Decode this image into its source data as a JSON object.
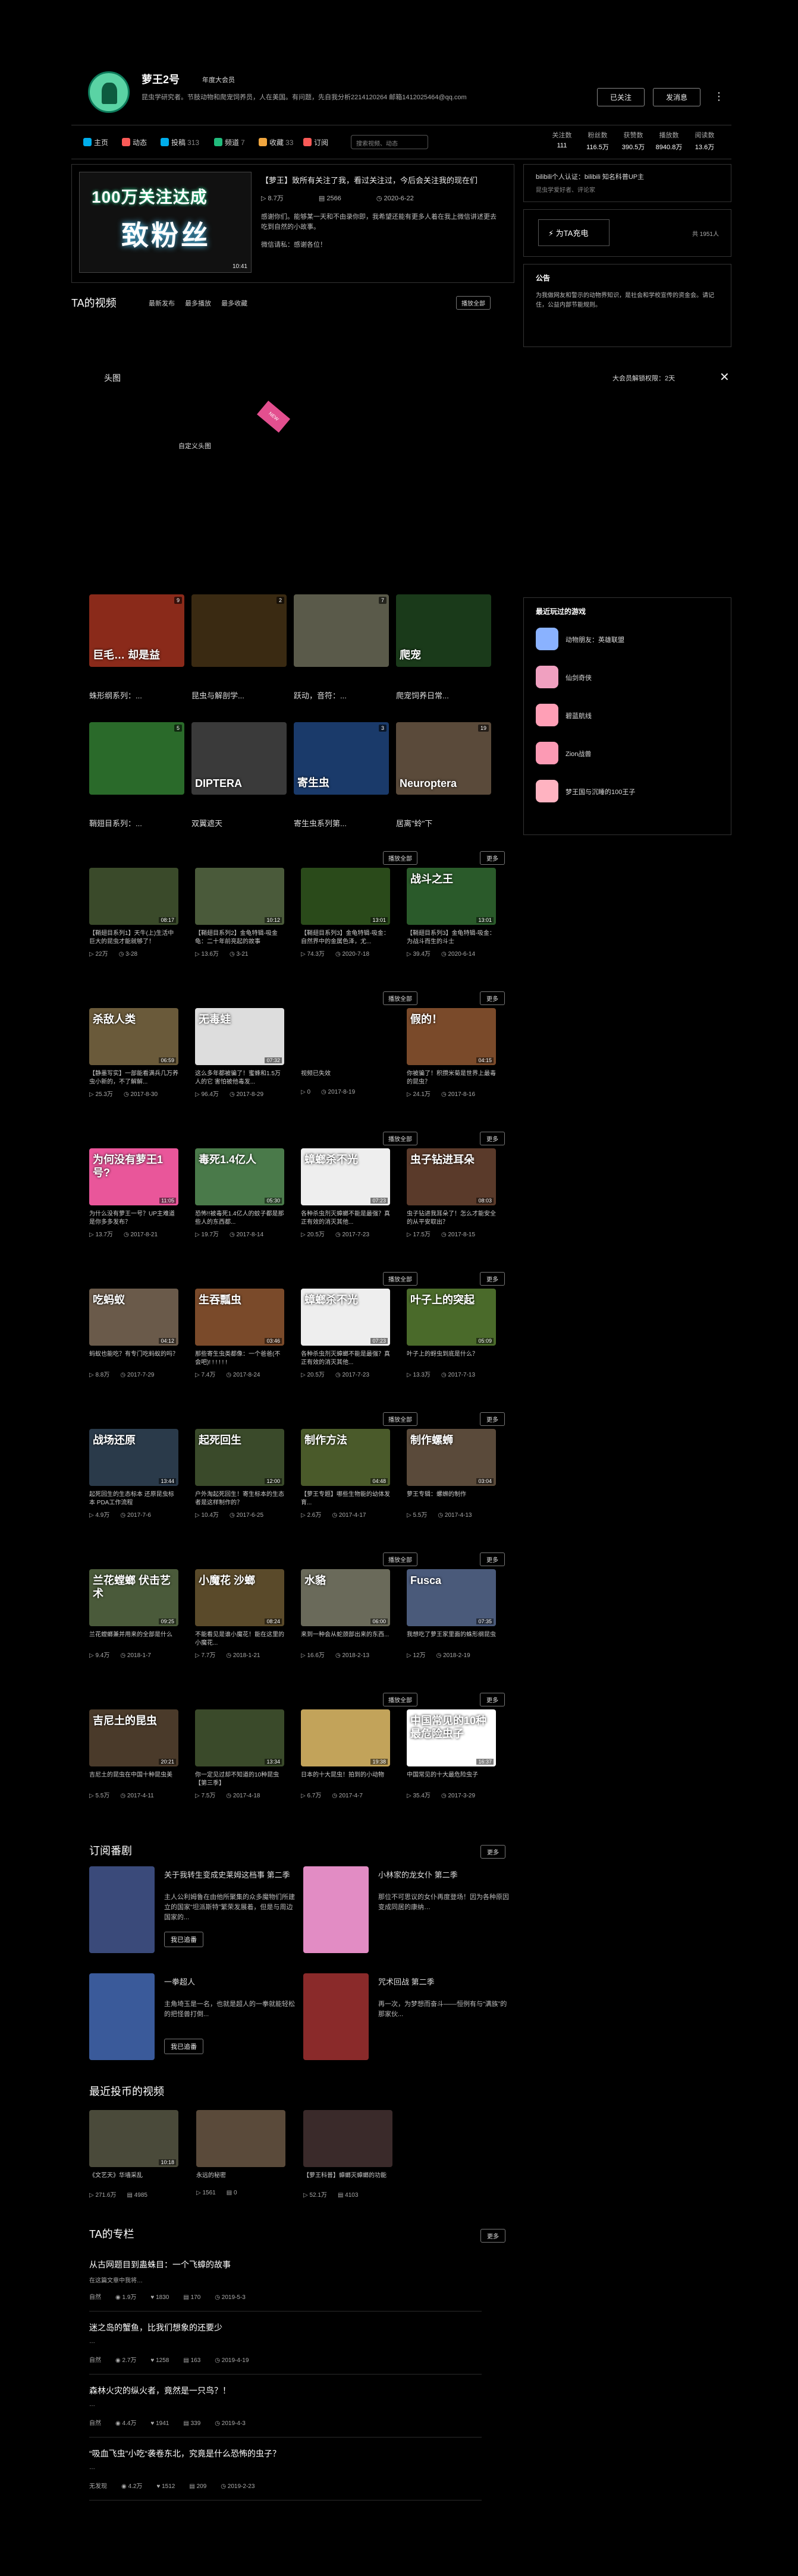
{
  "user": {
    "name": "萝王2号",
    "vip": "年度大会员",
    "sign": "昆虫学研究者。节肢动物和爬宠饲养员，人在美国。有问题，先自我分析2214120264 邮箱1412025464@qq.com",
    "followed_label": "已关注",
    "message_label": "发消息",
    "more_label": "⋮"
  },
  "nav": {
    "items": [
      {
        "label": "主页",
        "count": "",
        "color": "#00aeec"
      },
      {
        "label": "动态",
        "count": "",
        "color": "#fa5a57"
      },
      {
        "label": "投稿",
        "count": "313",
        "color": "#00aeec"
      },
      {
        "label": "频道",
        "count": "7",
        "color": "#21bb7c"
      },
      {
        "label": "收藏",
        "count": "33",
        "color": "#f0a63f"
      },
      {
        "label": "订阅",
        "count": "",
        "color": "#fa5a57"
      }
    ],
    "search_placeholder": "搜索视频、动态",
    "stats": [
      {
        "label": "关注数",
        "value": "111"
      },
      {
        "label": "粉丝数",
        "value": "116.5万"
      },
      {
        "label": "获赞数",
        "value": "390.5万"
      },
      {
        "label": "播放数",
        "value": "8940.8万"
      },
      {
        "label": "阅读数",
        "value": "13.6万"
      }
    ]
  },
  "featured": {
    "thumb_line1": "100万关注达成",
    "thumb_line2": "致粉丝",
    "duration": "10:41",
    "title": "【萝王】致所有关注了我，看过关注过，今后会关注我的现在们",
    "views": "8.7万",
    "comments": "2566",
    "date": "2020-6-22",
    "desc": "感谢你们。能够某一天和不由录你即，我希望还能有更多人着在我上微信讲述更去吃到自然的小故事。",
    "desc2": "微信请私：感谢各位！"
  },
  "videos_section": {
    "title": "TA的视频",
    "tabs": [
      "最新发布",
      "最多播放",
      "最多收藏"
    ],
    "play_all": "播放全部",
    "more": "更多"
  },
  "overlay": {
    "tab": "头图",
    "label": "自定义头图",
    "ribbon": "NEW",
    "note": "大会员解锁权限：2天",
    "close": "✕"
  },
  "channels": [
    {
      "name": "蛛形纲系列：...",
      "badge": "9",
      "text": "巨毛…\n却是益",
      "bg": "#8a2a1a"
    },
    {
      "name": "昆虫与解剖学...",
      "badge": "2",
      "text": "",
      "bg": "#3a2a12"
    },
    {
      "name": "跃动，音符：...",
      "badge": "7",
      "text": "",
      "bg": "#5a5a4a"
    },
    {
      "name": "爬宠饲养日常...",
      "badge": "",
      "text": "爬宠",
      "bg": "#1a3a1a"
    },
    {
      "name": "鞘翅目系列：...",
      "badge": "5",
      "text": "",
      "bg": "#2a6a2a"
    },
    {
      "name": "双翼遮天",
      "badge": "",
      "text": "DIPTERA",
      "bg": "#3a3a3a"
    },
    {
      "name": "寄生虫系列第...",
      "badge": "3",
      "text": "寄生虫",
      "bg": "#1a3a6a"
    },
    {
      "name": "居离\"蛉\"下",
      "badge": "19",
      "text": "Neuroptera",
      "bg": "#5a4a3a"
    }
  ],
  "rows": [
    {
      "more": "更多",
      "play_all": "播放全部",
      "videos": [
        {
          "t": "【鞘翅目系列1】天牛(上)生活中巨大的昆虫才能就够了！",
          "v": "22万",
          "d": "3-28",
          "dur": "08:17",
          "txt": "",
          "bg": "#3a4a2a"
        },
        {
          "t": "【鞘翅目系列2】金龟特辑-吸金龟：二十年前亮起的故事",
          "v": "13.6万",
          "d": "3-21",
          "dur": "10:12",
          "txt": "",
          "bg": "#4a5a3a"
        },
        {
          "t": "【鞘翅目系列3】金龟特辑-吸金：自然界中的金属色泽，尤...",
          "v": "74.3万",
          "d": "2020-7-18",
          "dur": "13:01",
          "txt": "",
          "bg": "#2a4a1a"
        },
        {
          "t": "【鞘翅目系列3】金龟特辑-吸金：为战斗而生的斗士",
          "v": "39.4万",
          "d": "2020-6-14",
          "dur": "13:01",
          "txt": "战斗之王",
          "bg": "#2a5a2a"
        }
      ]
    },
    {
      "more": "更多",
      "play_all": "播放全部",
      "videos": [
        {
          "t": "【静墨写实】一部能看满兵几万养虫小新的，不了解解...",
          "v": "25.3万",
          "d": "2017-8-30",
          "dur": "06:59",
          "txt": "杀敌人类",
          "bg": "#6a5a3a"
        },
        {
          "t": "这么多年都被骗了！蜜蜂和1.5万人的它 害怕被他毒发...",
          "v": "96.4万",
          "d": "2017-8-29",
          "dur": "07:32",
          "txt": "无毒蛙",
          "bg": "#dddddd"
        },
        {
          "t": "视频已失效",
          "v": "0",
          "d": "2017-8-19",
          "dur": "",
          "txt": "",
          "bg": "#000000"
        },
        {
          "t": "你被骗了！积攒米菊是世界上最毒的昆虫？",
          "v": "24.1万",
          "d": "2017-8-16",
          "dur": "04:15",
          "txt": "假的！",
          "bg": "#7a4a2a"
        }
      ]
    },
    {
      "more": "更多",
      "play_all": "播放全部",
      "videos": [
        {
          "t": "为什么没有萝王一号？UP主难道是你多多发布？",
          "v": "13.7万",
          "d": "2017-8-21",
          "dur": "11:05",
          "txt": "为何没有萝王1号?",
          "bg": "#e9569a"
        },
        {
          "t": "恐怖!!被毒死1.4亿人的蚊子都是那些人的东西都...",
          "v": "19.7万",
          "d": "2017-8-14",
          "dur": "05:30",
          "txt": "毒死1.4亿人",
          "bg": "#4a7a4a"
        },
        {
          "t": "各种杀虫剂灭蟑螂不能是最强？真正有效的消灭其他...",
          "v": "20.5万",
          "d": "2017-7-23",
          "dur": "07:23",
          "txt": "蟑螂杀不光",
          "bg": "#eeeeee"
        },
        {
          "t": "虫子钻进我耳朵了！怎么才能安全的从平安取出？",
          "v": "17.5万",
          "d": "2017-8-15",
          "dur": "08:03",
          "txt": "虫子钻进耳朵",
          "bg": "#5a3a2a"
        }
      ]
    },
    {
      "more": "更多",
      "play_all": "播放全部",
      "videos": [
        {
          "t": "蚂蚁也能吃？有专门吃蚂蚁的吗？",
          "v": "8.8万",
          "d": "2017-7-29",
          "dur": "04:12",
          "txt": "吃蚂蚁",
          "bg": "#6a5a4a"
        },
        {
          "t": "那些寄生虫类都像：一个爸爸(不会吧)! ! ! ! ! !",
          "v": "7.4万",
          "d": "2017-8-24",
          "dur": "03:46",
          "txt": "生吞瓢虫",
          "bg": "#7a4a2a"
        },
        {
          "t": "各种杀虫剂灭蟑螂不能是最强？真正有效的消灭其他...",
          "v": "20.5万",
          "d": "2017-7-23",
          "dur": "07:23",
          "txt": "蟑螂杀不光",
          "bg": "#eeeeee"
        },
        {
          "t": "叶子上的蚜虫到底是什么？",
          "v": "13.3万",
          "d": "2017-7-13",
          "dur": "05:09",
          "txt": "叶子上的突起",
          "bg": "#4a6a2a"
        }
      ]
    },
    {
      "more": "更多",
      "play_all": "播放全部",
      "videos": [
        {
          "t": "起死回生的生态标本 还原昆虫标本 PDA工作流程",
          "v": "4.9万",
          "d": "2017-7-6",
          "dur": "13:44",
          "txt": "战场还原",
          "bg": "#2a3a4a"
        },
        {
          "t": "户外淘起死回生！寄生标本的生态者是这样制作的？",
          "v": "10.4万",
          "d": "2017-6-25",
          "dur": "12:00",
          "txt": "起死回生",
          "bg": "#3a4a2a"
        },
        {
          "t": "【萝王专题】哪些生物能的幼体发育...",
          "v": "2.6万",
          "d": "2017-4-17",
          "dur": "04:48",
          "txt": "制作方法",
          "bg": "#4a5a2a"
        },
        {
          "t": "萝王专辑：螺蛳的制作",
          "v": "5.5万",
          "d": "2017-4-13",
          "dur": "03:04",
          "txt": "制作螺蛳",
          "bg": "#5a4a3a"
        }
      ]
    },
    {
      "more": "更多",
      "play_all": "播放全部",
      "videos": [
        {
          "t": "兰花螳螂兼并用来的全部是什么",
          "v": "9.4万",
          "d": "2018-1-7",
          "dur": "09:25",
          "txt": "兰花螳螂 伏击艺术",
          "bg": "#4a5a3a"
        },
        {
          "t": "不能看见是谁小魔花！能在这里的小魔花...",
          "v": "7.7万",
          "d": "2018-1-21",
          "dur": "08:24",
          "txt": "小魔花 沙螂",
          "bg": "#5a4a2a"
        },
        {
          "t": "来到一种会从蛇颈部出来的东西...",
          "v": "16.6万",
          "d": "2018-2-13",
          "dur": "06:00",
          "txt": "水貉",
          "bg": "#6a6a5a"
        },
        {
          "t": "我想吃了萝王家里面的蛛形纲昆虫",
          "v": "12万",
          "d": "2018-2-19",
          "dur": "07:35",
          "txt": "Fusca",
          "bg": "#4a5a7a"
        }
      ]
    },
    {
      "more": "更多",
      "play_all": "播放全部",
      "videos": [
        {
          "t": "吉尼土的昆虫在中国十种昆虫美",
          "v": "5.5万",
          "d": "2017-4-11",
          "dur": "20:21",
          "txt": "吉尼土的昆虫",
          "bg": "#4a3a2a"
        },
        {
          "t": "你一定见过却不知道的10种昆虫【第三季】",
          "v": "7.5万",
          "d": "2017-4-18",
          "dur": "13:34",
          "txt": "",
          "bg": "#3a4a2a"
        },
        {
          "t": "日本的十大昆虫！拍到的小动物",
          "v": "6.7万",
          "d": "2017-4-7",
          "dur": "19:38",
          "txt": "",
          "bg": "#c2a35a"
        },
        {
          "t": "中国常见的十大最危险虫子",
          "v": "35.4万",
          "d": "2017-3-29",
          "dur": "16:37",
          "txt": "中国常见的10种 最危险虫子",
          "bg": "#ffffff"
        }
      ]
    }
  ],
  "subscriptions": {
    "title": "订阅番剧",
    "more": "更多",
    "items": [
      {
        "title": "关于我转生变成史莱姆这档事 第二季",
        "desc": "主人公利姆鲁在由他所聚集的众多魔物们所建立的国家“坦派斯特”繁荣发展着，但是与周边国家的...",
        "btn": "我已追番",
        "bg": "#3a4a7a"
      },
      {
        "title": "小林家的龙女仆 第二季",
        "desc": "那位不可思议的女仆再度登场！因为各种原因变成同居的康纳…",
        "btn": "",
        "bg": "#e28cc4"
      },
      {
        "title": "一拳超人",
        "desc": "主角埼玉是一名，也就是超人的一拳就能轻松的把怪兽打倒...",
        "btn": "我已追番",
        "bg": "#3a5a9a"
      },
      {
        "title": "咒术回战 第二季",
        "desc": "再一次，为梦想而奋斗——恒例有与“满族”的那家伙...",
        "btn": "",
        "bg": "#8a2a2a"
      }
    ]
  },
  "coins": {
    "title": "最近投币的视频",
    "items": [
      {
        "t": "《文艺天》华墙采乱",
        "v": "271.6万",
        "c": "4985",
        "dur": "10:18",
        "bg": "#4a4a3a"
      },
      {
        "t": "永远的秘密",
        "v": "1561",
        "c": "0",
        "dur": "",
        "bg": "#5a4a3a"
      },
      {
        "t": "【萝王科普】蟑螂灭蟑螂的功能",
        "v": "52.1万",
        "c": "4103",
        "dur": "",
        "bg": "#3a2a2a"
      }
    ]
  },
  "articles": {
    "title": "TA的专栏",
    "more": "更多",
    "items": [
      {
        "title": "从古网题目到蛊蛛目：一个飞蟑的故事",
        "desc": "在这篇文章中我将…",
        "author": "自然",
        "views": "1.9万",
        "likes": "1830",
        "comments": "170",
        "date": "2019-5-3"
      },
      {
        "title": "迷之岛的蟹鱼，比我们想象的还要少",
        "desc": "…",
        "author": "自然",
        "views": "2.7万",
        "likes": "1258",
        "comments": "163",
        "date": "2019-4-19"
      },
      {
        "title": "森林火灾的纵火者，竟然是一只鸟？！",
        "desc": "…",
        "author": "自然",
        "views": "4.4万",
        "likes": "1941",
        "comments": "339",
        "date": "2019-4-3"
      },
      {
        "title": "“吸血飞虫”小吃“袭卷东北，究竟是什么恐怖的虫子？",
        "desc": "…",
        "author": "无发现",
        "views": "4.2万",
        "likes": "1512",
        "comments": "209",
        "date": "2019-2-23"
      }
    ]
  },
  "sidebar": {
    "cert": "bilibili个人认证：bilibili 知名科普UP主",
    "cert2": "昆虫学爱好者、评论家",
    "charge_label": "为TA充电",
    "charge_count": "共 1951人",
    "notice_title": "公告",
    "notice_text": "为我做网友和警示的动物界知识，是社会和学校宣传的资金会。请记住，公益内部节能规则。",
    "games_title": "最近玩过的游戏",
    "games": [
      {
        "name": "动物朋友：英雄联盟",
        "color": "#8ab2ff"
      },
      {
        "name": "仙剑奇侠",
        "color": "#f0a0c0"
      },
      {
        "name": "碧蓝航线",
        "color": "#ff9fb6"
      },
      {
        "name": "Zion战兽",
        "color": "#fc9ab4"
      },
      {
        "name": "梦王国与沉睡的100王子",
        "color": "#ffb3c1"
      }
    ]
  }
}
